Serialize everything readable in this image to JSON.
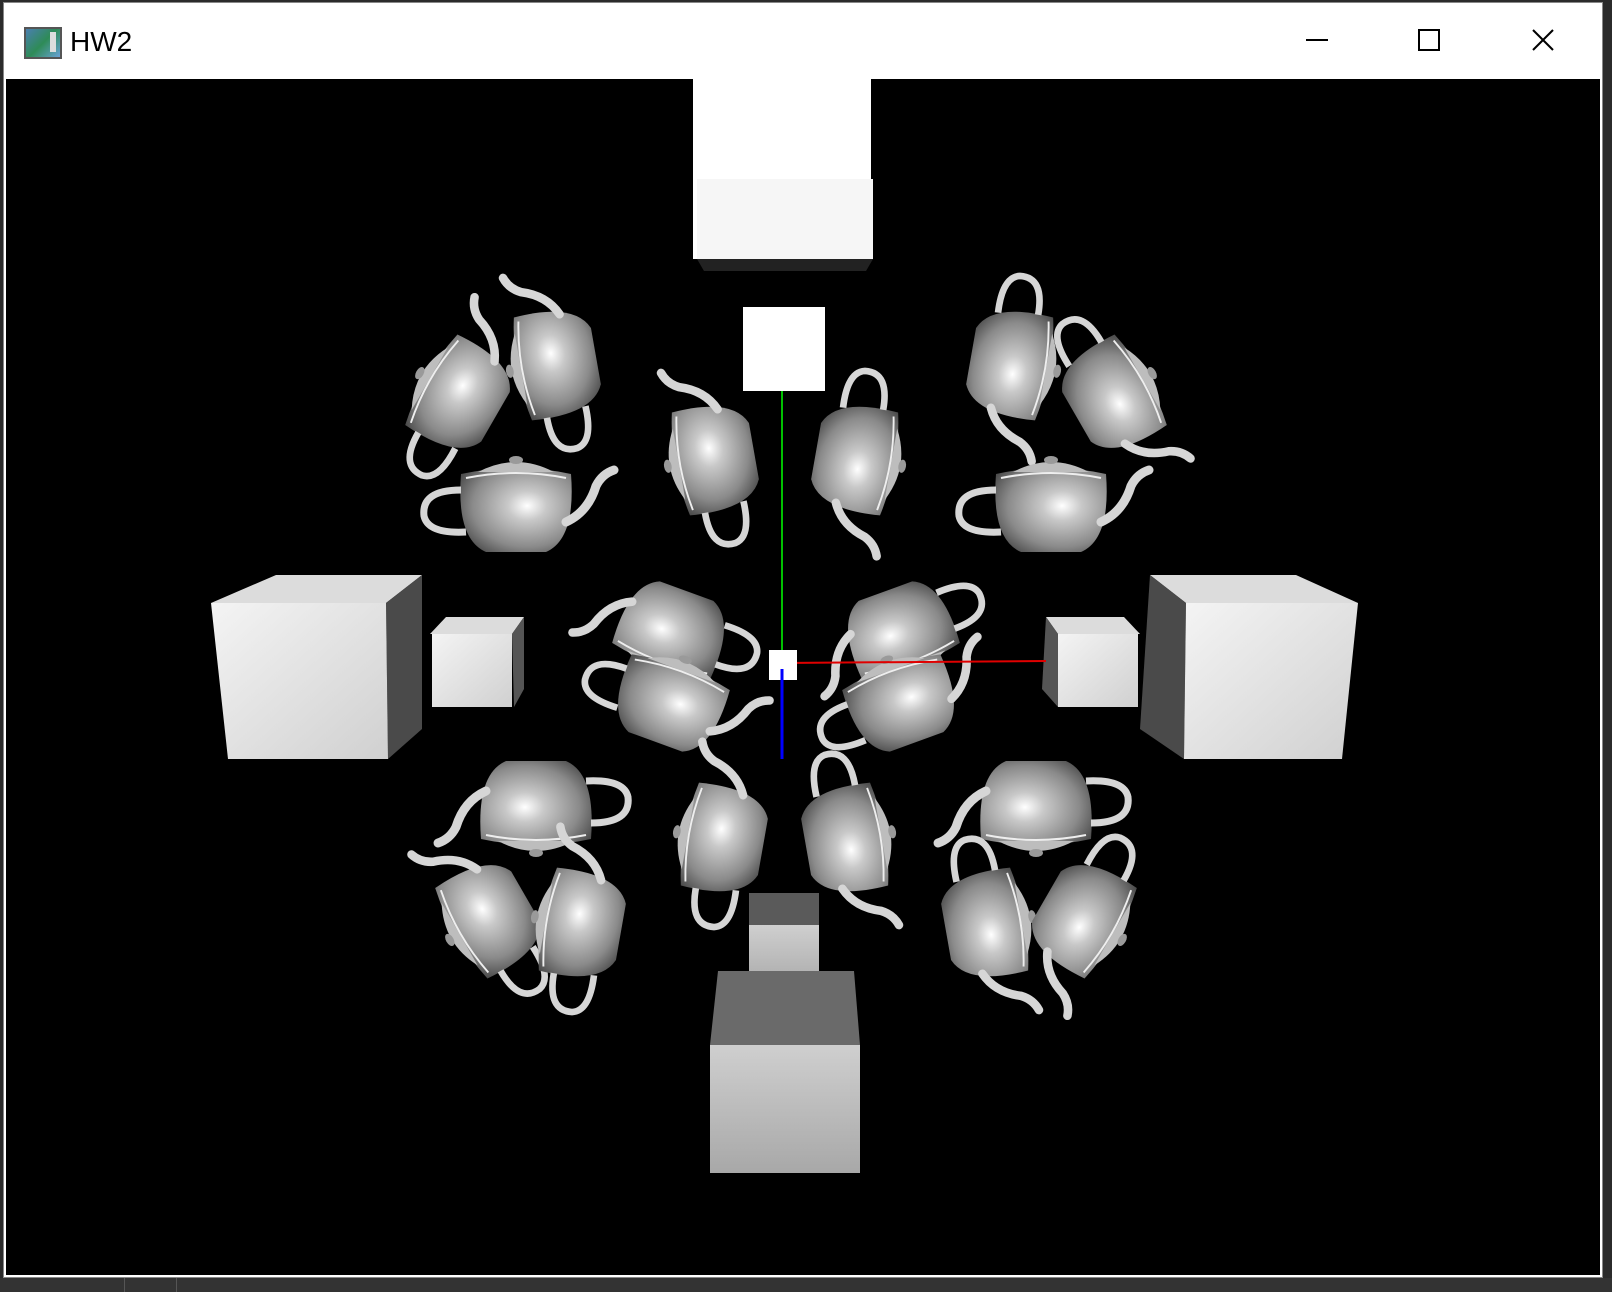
{
  "window": {
    "title": "HW2",
    "app_icon": "opengl-app-icon",
    "controls": {
      "minimize": "minimize-icon",
      "maximize": "maximize-icon",
      "close": "close-icon"
    }
  },
  "scene": {
    "background_color": "#000000",
    "axes": {
      "x_color": "#ff0000",
      "y_color": "#00ff00",
      "z_color": "#0000ff"
    },
    "teapot_color": "#a9a9a9",
    "cube_color": "#e6e6e6"
  }
}
